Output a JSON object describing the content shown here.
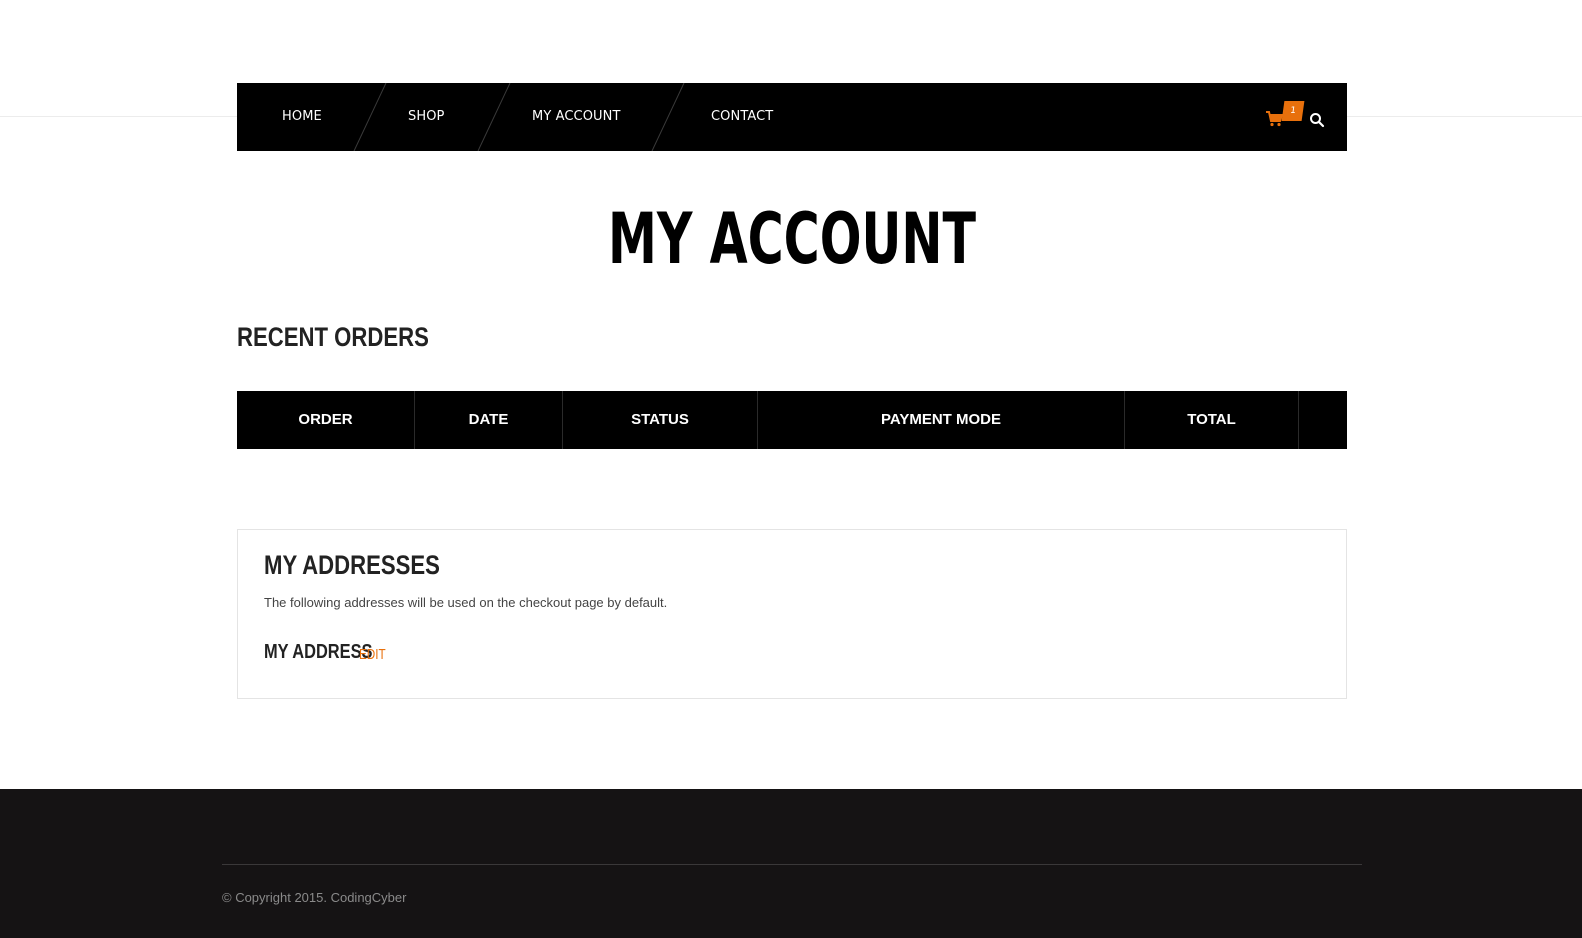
{
  "nav": {
    "items": [
      {
        "label": "HOME"
      },
      {
        "label": "SHOP"
      },
      {
        "label": "MY ACCOUNT"
      },
      {
        "label": "CONTACT"
      }
    ],
    "cart_count": "1",
    "accent_color": "#e8700c"
  },
  "page": {
    "title": "MY ACCOUNT"
  },
  "recent_orders": {
    "title": "RECENT ORDERS",
    "columns": [
      "ORDER",
      "DATE",
      "STATUS",
      "PAYMENT MODE",
      "TOTAL",
      ""
    ]
  },
  "addresses": {
    "title": "MY ADDRESSES",
    "description": "The following addresses will be used on the checkout page by default.",
    "subtitle": "MY ADDRESS",
    "edit_label": "EDIT"
  },
  "footer": {
    "copyright": "© Copyright 2015. CodingCyber"
  },
  "icons": {
    "cart": "cart-icon",
    "search": "search-icon"
  }
}
